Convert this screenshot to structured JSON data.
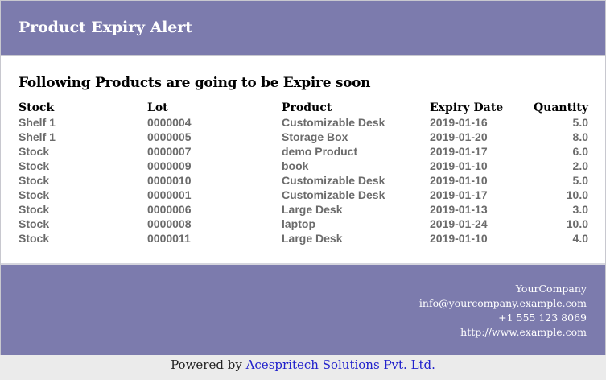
{
  "header": {
    "title": "Product Expiry Alert"
  },
  "content": {
    "intro": "Following Products are going to be Expire soon",
    "columns": {
      "stock": "Stock",
      "lot": "Lot",
      "product": "Product",
      "expiry_date": "Expiry Date",
      "quantity": "Quantity"
    },
    "rows": [
      {
        "stock": "Shelf 1",
        "lot": "0000004",
        "product": "Customizable Desk",
        "expiry_date": "2019-01-16",
        "quantity": "5.0"
      },
      {
        "stock": "Shelf 1",
        "lot": "0000005",
        "product": "Storage Box",
        "expiry_date": "2019-01-20",
        "quantity": "8.0"
      },
      {
        "stock": "Stock",
        "lot": "0000007",
        "product": "demo Product",
        "expiry_date": "2019-01-17",
        "quantity": "6.0"
      },
      {
        "stock": "Stock",
        "lot": "0000009",
        "product": "book",
        "expiry_date": "2019-01-10",
        "quantity": "2.0"
      },
      {
        "stock": "Stock",
        "lot": "0000010",
        "product": "Customizable Desk",
        "expiry_date": "2019-01-10",
        "quantity": "5.0"
      },
      {
        "stock": "Stock",
        "lot": "0000001",
        "product": "Customizable Desk",
        "expiry_date": "2019-01-17",
        "quantity": "10.0"
      },
      {
        "stock": "Stock",
        "lot": "0000006",
        "product": "Large Desk",
        "expiry_date": "2019-01-13",
        "quantity": "3.0"
      },
      {
        "stock": "Stock",
        "lot": "0000008",
        "product": "laptop",
        "expiry_date": "2019-01-24",
        "quantity": "10.0"
      },
      {
        "stock": "Stock",
        "lot": "0000011",
        "product": "Large Desk",
        "expiry_date": "2019-01-10",
        "quantity": "4.0"
      }
    ]
  },
  "footer": {
    "company": "YourCompany",
    "email": "info@yourcompany.example.com",
    "phone": "+1 555 123 8069",
    "website": "http://www.example.com"
  },
  "powered_by": {
    "prefix": "Powered by",
    "link_text": "Acespritech Solutions Pvt. Ltd."
  },
  "colors": {
    "header_bg": "#7c7bad",
    "footer_bg": "#7c7bad",
    "cell_text": "#6b6b6b",
    "link": "#2222cc"
  }
}
